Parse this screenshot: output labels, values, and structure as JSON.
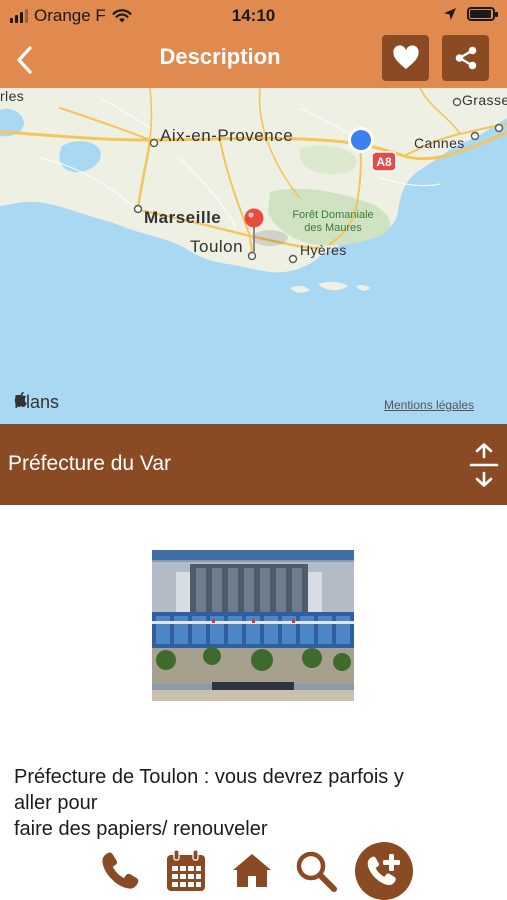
{
  "status_bar": {
    "carrier": "Orange F",
    "time": "14:10",
    "battery_level": 0.95
  },
  "nav": {
    "title": "Description",
    "icons": [
      "chevron-left-icon",
      "heart-icon",
      "share-icon"
    ]
  },
  "map": {
    "labels": {
      "arles": "rles",
      "grasse": "Grasse",
      "aix": "Aix-en-Provence",
      "cannes": "Cannes",
      "marseille": "Marseille",
      "foret_1": "Forêt Domaniale",
      "foret_2": "des Maures",
      "toulon": "Toulon",
      "hyeres": "Hyères",
      "highway": "A8"
    },
    "attribution": "Plans",
    "legal_link": "Mentions légales",
    "colors": {
      "sea": "#a9d8f3",
      "land": "#eef0e4",
      "forest": "#cfe3c2",
      "road": "#f4c55a",
      "pin": "#e84b3c",
      "location": "#3b82f0"
    }
  },
  "place": {
    "name": "Préfecture du Var",
    "expand_icon": "expand-vertical-icon"
  },
  "description": {
    "line1": "Préfecture de Toulon : vous devrez parfois y",
    "line2": "aller pour",
    "line3": "faire des papiers/ renouveler"
  },
  "toolbar": {
    "items": [
      "phone-icon",
      "calendar-icon",
      "home-icon",
      "search-icon",
      "add-call-icon"
    ],
    "accent": "#8a4b24"
  },
  "theme": {
    "header_orange": "#e08a4f",
    "brown": "#8a4b24"
  }
}
